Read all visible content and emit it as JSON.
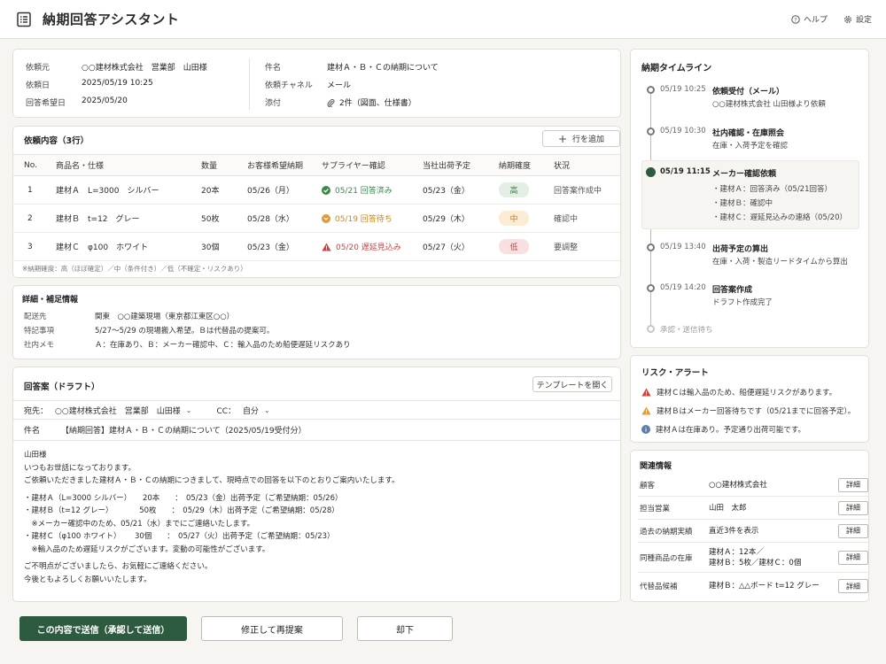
{
  "header": {
    "title": "納期回答アシスタント",
    "help": "ヘルプ",
    "settings": "設定"
  },
  "info": {
    "rows_left": [
      {
        "k": "依頼元",
        "v": "○○建材株式会社　営業部　山田様"
      },
      {
        "k": "依頼日",
        "v": "2025/05/19 10:25"
      },
      {
        "k": "回答希望日",
        "v": "2025/05/20"
      }
    ],
    "rows_right": [
      {
        "k": "件名",
        "v": "建材Ａ・Ｂ・Ｃの納期について"
      },
      {
        "k": "依頼チャネル",
        "v": "メール"
      },
      {
        "k": "添付",
        "v": "2件（図面、仕様書）"
      }
    ]
  },
  "request": {
    "title": "依頼内容（3行）",
    "add_row": "行を追加",
    "columns": [
      "No.",
      "商品名・仕様",
      "数量",
      "お客様希望納期",
      "サプライヤー確認",
      "当社出荷予定",
      "納期確度",
      "状況"
    ],
    "rows": [
      {
        "no": "1",
        "name": "建材Ａ　L=3000　シルバー",
        "qty": "20本",
        "wish": "05/26（月）",
        "sup": "05/21 回答済み",
        "ship": "05/23（金）",
        "conf": "高",
        "status": "回答案作成中"
      },
      {
        "no": "2",
        "name": "建材Ｂ　t=12　グレー",
        "qty": "50枚",
        "wish": "05/28（水）",
        "sup": "05/19 回答待ち",
        "ship": "05/29（木）",
        "conf": "中",
        "status": "確認中"
      },
      {
        "no": "3",
        "name": "建材Ｃ　φ100　ホワイト",
        "qty": "30個",
        "wish": "05/23（金）",
        "sup": "05/20 遅延見込み",
        "ship": "05/27（火）",
        "conf": "低",
        "status": "要調整"
      }
    ],
    "footnote": "※納期確度：高（ほぼ確定）／中（条件付き）／低（不確定・リスクあり）"
  },
  "detail": {
    "title": "詳細・補足情報",
    "rows": [
      {
        "k": "配送先",
        "v": "関東　○○建築現場（東京都江東区○○）"
      },
      {
        "k": "特記事項",
        "v": "5/27〜5/29 の現場搬入希望。Ｂは代替品の提案可。"
      },
      {
        "k": "社内メモ",
        "v": "Ａ：在庫あり、Ｂ：メーカー確認中、Ｃ：輸入品のため船便遅延リスクあり"
      }
    ]
  },
  "draft": {
    "title": "回答案（ドラフト）",
    "template_btn": "テンプレートを開く",
    "to_label": "宛先：",
    "to": "○○建材株式会社　営業部　山田様",
    "cc_label": "CC：",
    "cc": "自分",
    "subject_label": "件名",
    "subject": "【納期回答】建材Ａ・Ｂ・Ｃの納期について（2025/05/19受付分）",
    "body": [
      "山田様",
      "いつもお世話になっております。",
      "ご依頼いただきました建材Ａ・Ｂ・Ｃの納期につきまして、現時点での回答を以下のとおりご案内いたします。",
      "",
      "・建材Ａ（L=3000 シルバー）　　20本　　：　05/23（金）出荷予定（ご希望納期：05/26）",
      "・建材Ｂ（t=12 グレー）　　　　50枚　　：　05/29（木）出荷予定（ご希望納期：05/28）",
      "　※メーカー確認中のため、05/21（水）までにご連絡いたします。",
      "・建材Ｃ（φ100 ホワイト）　　 30個　　：　05/27（火）出荷予定（ご希望納期：05/23）",
      "　※輸入品のため遅延リスクがございます。変動の可能性がございます。",
      "",
      "ご不明点がございましたら、お気軽にご連絡ください。",
      "今後ともよろしくお願いいたします。"
    ]
  },
  "actions": {
    "send": "この内容で送信（承認して送信）",
    "revise": "修正して再提案",
    "reject": "却下"
  },
  "timeline": {
    "title": "納期タイムライン",
    "items": [
      {
        "time": "05/19 10:25",
        "title": "依頼受付（メール）",
        "sub": "○○建材株式会社 山田様より依頼"
      },
      {
        "time": "05/19 10:30",
        "title": "社内確認・在庫照会",
        "sub": "在庫・入荷予定を確認"
      },
      {
        "time": "05/19 11:15",
        "title": "メーカー確認依頼",
        "subs": [
          "・建材Ａ：回答済み（05/21回答）",
          "・建材Ｂ：確認中",
          "・建材Ｃ：遅延見込みの連絡（05/20）"
        ]
      },
      {
        "time": "05/19 13:40",
        "title": "出荷予定の算出",
        "sub": "在庫・入荷・製造リードタイムから算出"
      },
      {
        "time": "05/19 14:20",
        "title": "回答案作成",
        "sub": "ドラフト作成完了"
      },
      {
        "time": "承認・送信待ち"
      }
    ]
  },
  "risk": {
    "title": "リスク・アラート",
    "items": [
      "建材Ｃは輸入品のため、船便遅延リスクがあります。",
      "建材Ｂはメーカー回答待ちです（05/21までに回答予定）。",
      "建材Ａは在庫あり。予定通り出荷可能です。"
    ]
  },
  "related": {
    "title": "関連情報",
    "detail_btn": "詳細",
    "rows": [
      {
        "k": "顧客",
        "v": "○○建材株式会社"
      },
      {
        "k": "担当営業",
        "v": "山田　太郎"
      },
      {
        "k": "過去の納期実績",
        "v": "直近3件を表示"
      },
      {
        "k": "同種商品の在庫",
        "v": "建材Ａ：12本／",
        "v2": "建材Ｂ：5枚／建材Ｃ：0個"
      },
      {
        "k": "代替品候補",
        "v": "建材Ｂ：△△ボード t=12 グレー"
      }
    ]
  },
  "colors": {
    "accent": "#2d5b3f",
    "ok": "#3c8a4a",
    "warn": "#d98a2b",
    "danger": "#c94444",
    "info": "#5a7fa8"
  }
}
